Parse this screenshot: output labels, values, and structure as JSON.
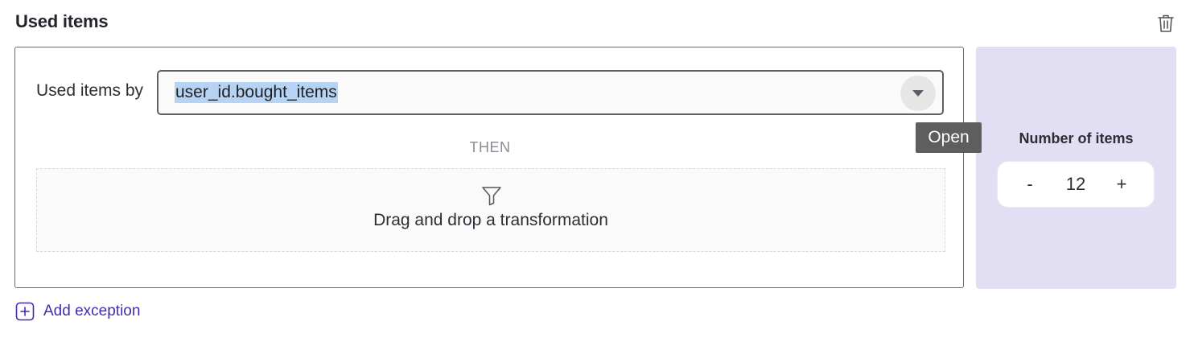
{
  "section": {
    "title": "Used items"
  },
  "filter": {
    "label": "Used items by",
    "value": "user_id.bought_items",
    "dropdown_tooltip": "Open"
  },
  "then_label": "THEN",
  "drop_zone": {
    "text": "Drag and drop a transformation"
  },
  "side_panel": {
    "title": "Number of items",
    "minus_label": "-",
    "value": "12",
    "plus_label": "+"
  },
  "footer": {
    "add_exception_label": "Add exception"
  },
  "colors": {
    "accent": "#3d2fb5",
    "side_panel_bg": "#e2dff4",
    "selection_highlight": "#b7d3f3",
    "tooltip_bg": "#5e5e5e"
  },
  "icons": {
    "delete": "trash-icon",
    "dropdown": "caret-down-icon",
    "transformation": "filter-icon",
    "add": "plus-square-icon"
  }
}
